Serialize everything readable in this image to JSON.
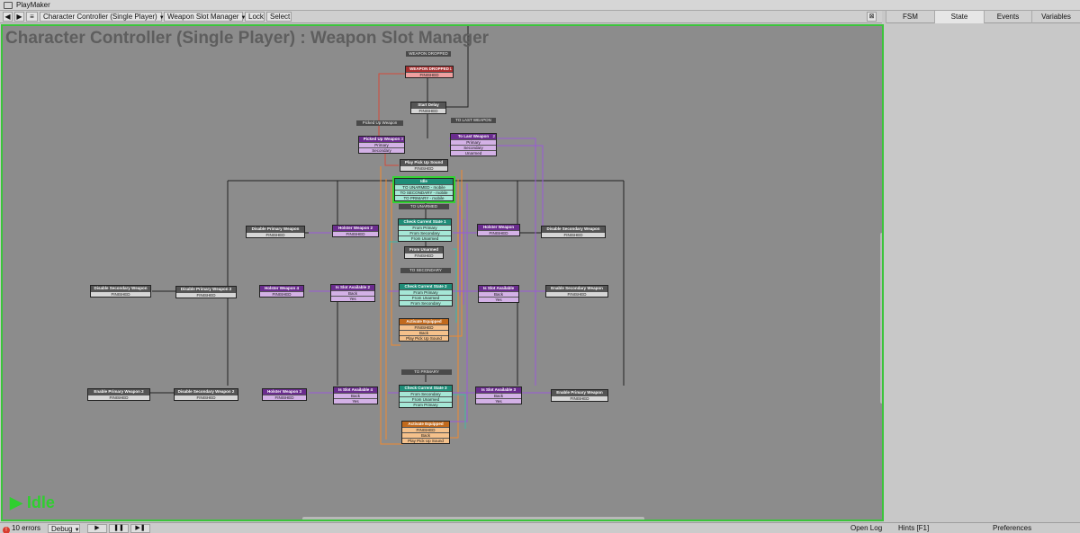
{
  "window": {
    "title": "PlayMaker"
  },
  "toolbar": {
    "fsm_selector": "Character Controller (Single Player)",
    "state_selector": "Weapon Slot Manager",
    "lock": "Lock",
    "select": "Select"
  },
  "right_tabs": [
    "FSM",
    "State",
    "Events",
    "Variables"
  ],
  "canvas": {
    "title": "Character Controller (Single Player) : Weapon Slot Manager",
    "status": "Idle"
  },
  "statusbar": {
    "errors": "10 errors",
    "debug": "Debug",
    "open_log": "Open Log",
    "hints": "Hints [F1]",
    "preferences": "Preferences"
  },
  "colors": {
    "accent_green": "#3cc43c",
    "state_gray": "#555555",
    "state_purple": "#6a2c8e",
    "state_teal": "#1f8d78",
    "state_orange": "#c16a1d",
    "state_red": "#a93030"
  },
  "graph": {
    "labels": [
      "WEAPON DROPPED",
      "TO LAST WEAPON",
      "Picked Up Weapon",
      "TO UNARMED",
      "TO SECONDARY",
      "TO PRIMARY"
    ],
    "states": [
      {
        "name": "WEAPON DROPPED",
        "events": [
          "FINISHED"
        ]
      },
      {
        "name": "Start Delay",
        "events": [
          "FINISHED"
        ]
      },
      {
        "name": "Picked Up Weapon",
        "events": [
          "Primary",
          "Secondary"
        ]
      },
      {
        "name": "To Last Weapon",
        "events": [
          "Primary",
          "Secondary",
          "Unarmed"
        ]
      },
      {
        "name": "Play Pick Up Sound",
        "events": [
          "FINISHED"
        ]
      },
      {
        "name": "Idle",
        "events": [
          "TO UNARMED - mobile",
          "TO SECONDARY - mobile",
          "TO PRIMARY - mobile"
        ]
      },
      {
        "name": "Check Current State 1",
        "events": [
          "From Primary",
          "From Secondary",
          "From Unarmed"
        ]
      },
      {
        "name": "From Unarmed",
        "events": [
          "FINISHED"
        ]
      },
      {
        "name": "Holster Weapon 2",
        "events": [
          "FINISHED"
        ]
      },
      {
        "name": "Disable Primary Weapon",
        "events": [
          "FINISHED"
        ]
      },
      {
        "name": "Holster Weapon",
        "events": [
          "FINISHED"
        ]
      },
      {
        "name": "Disable Secondary Weapon",
        "events": [
          "FINISHED"
        ]
      },
      {
        "name": "Check Current State 2",
        "events": [
          "From Primary",
          "From Unarmed",
          "From Secondary"
        ]
      },
      {
        "name": "Is Slot Available 2",
        "events": [
          "Back",
          "Yes"
        ]
      },
      {
        "name": "Holster Weapon 4",
        "events": [
          "FINISHED"
        ]
      },
      {
        "name": "Disable Primary Weapon 2",
        "events": [
          "FINISHED"
        ]
      },
      {
        "name": "Disable Secondary Weapon",
        "events": [
          "FINISHED"
        ]
      },
      {
        "name": "Is Slot Available",
        "events": [
          "Back",
          "Yes"
        ]
      },
      {
        "name": "Enable Secondary Weapon",
        "events": [
          "FINISHED"
        ]
      },
      {
        "name": "Activate Equipped",
        "events": [
          "FINISHED",
          "Back",
          "Play Pick Up Sound"
        ]
      },
      {
        "name": "Check Current State 3",
        "events": [
          "From Secondary",
          "From Unarmed",
          "From Primary"
        ]
      },
      {
        "name": "Is Slot Available 4",
        "events": [
          "Back",
          "Yes"
        ]
      },
      {
        "name": "Holster Weapon 3",
        "events": [
          "FINISHED"
        ]
      },
      {
        "name": "Disable Secondary Weapon 2",
        "events": [
          "FINISHED"
        ]
      },
      {
        "name": "Enable Primary Weapon 2",
        "events": [
          "FINISHED"
        ]
      },
      {
        "name": "Is Slot Available 3",
        "events": [
          "Back",
          "Yes"
        ]
      },
      {
        "name": "Enable Primary Weapon",
        "events": [
          "FINISHED"
        ]
      },
      {
        "name": "Activate Equipped",
        "events": [
          "FINISHED",
          "Back",
          "Play Pick Up Sound"
        ]
      }
    ]
  }
}
